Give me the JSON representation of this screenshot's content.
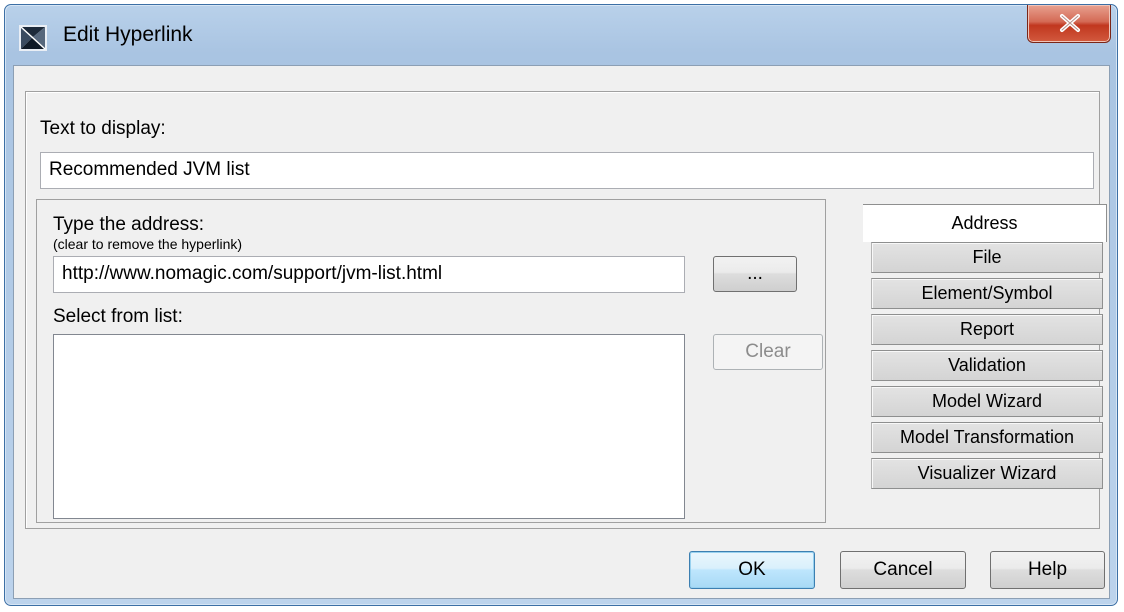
{
  "window": {
    "title": "Edit Hyperlink"
  },
  "form": {
    "text_to_display_label": "Text to display:",
    "text_to_display_value": "Recommended JVM list",
    "type_address_label": "Type the address:",
    "type_address_hint": "(clear to remove the hyperlink)",
    "address_value": "http://www.nomagic.com/support/jvm-list.html",
    "browse_label": "...",
    "select_from_list_label": "Select from list:",
    "clear_label": "Clear"
  },
  "tabs": [
    {
      "label": "Address",
      "active": true
    },
    {
      "label": "File",
      "active": false
    },
    {
      "label": "Element/Symbol",
      "active": false
    },
    {
      "label": "Report",
      "active": false
    },
    {
      "label": "Validation",
      "active": false
    },
    {
      "label": "Model Wizard",
      "active": false
    },
    {
      "label": "Model Transformation",
      "active": false
    },
    {
      "label": "Visualizer Wizard",
      "active": false
    }
  ],
  "footer": {
    "ok_label": "OK",
    "cancel_label": "Cancel",
    "help_label": "Help"
  },
  "colors": {
    "frame": "#a9c4e2",
    "close_button": "#c1371f",
    "default_button": "#bee6fd"
  }
}
